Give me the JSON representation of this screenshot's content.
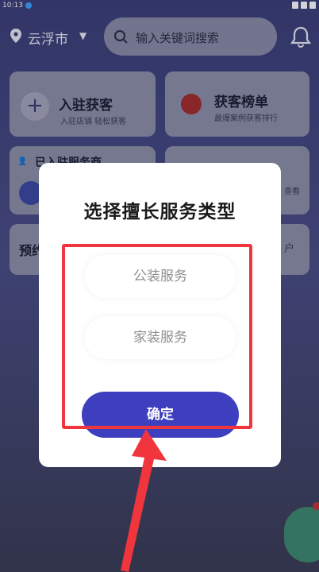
{
  "status_bar": {
    "time": "10:13"
  },
  "top_bar": {
    "location": "云浮市",
    "search_placeholder": "输入关键词搜索"
  },
  "cards": {
    "join": {
      "title": "入驻获客",
      "subtitle": "入驻店铺  轻松获客"
    },
    "ranking": {
      "title": "获客榜单",
      "subtitle": "最爆案例获客排行"
    },
    "joined_partial": "已入驻服务商",
    "right_partial": "查看",
    "bottom_left_partial": "预约",
    "bottom_right_partial": "户"
  },
  "dialog": {
    "title": "选择擅长服务类型",
    "options": [
      {
        "label": "公装服务"
      },
      {
        "label": "家装服务"
      }
    ],
    "confirm_label": "确定"
  },
  "colors": {
    "accent": "#3d3fbf",
    "annotation_red": "#f0353d"
  }
}
